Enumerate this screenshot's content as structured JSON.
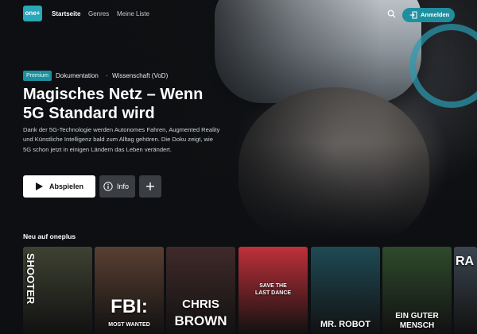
{
  "nav": {
    "logo_text": "one",
    "links": [
      "Startseite",
      "Genres",
      "Meine Liste"
    ],
    "login_label": "Anmelden",
    "accent_color": "#1e8f9f"
  },
  "hero": {
    "badge": "Premium",
    "category": "Dokumentation",
    "separator": "·",
    "genre": "Wissenschaft (VoD)",
    "title_line1": "Magisches Netz – Wenn",
    "title_line2": "5G Standard wird",
    "description": "Dank der 5G-Technologie werden Autonomes Fahren, Augmented Reality und Künstliche Intelligenz bald zum Alltag gehören. Die Doku zeigt, wie 5G schon jetzt in einigen Ländern das Leben verändert.",
    "play_label": "Abspielen",
    "info_label": "Info"
  },
  "row": {
    "title": "Neu auf oneplus",
    "posters": [
      {
        "title": "SHOOTER",
        "color": "#3e4232"
      },
      {
        "title": "FBI:",
        "subtitle": "MOST WANTED",
        "color": "#5a3f32"
      },
      {
        "title": "CHRIS",
        "subtitle": "BROWN",
        "color": "#402a2a"
      },
      {
        "title": "SAVE THE",
        "subtitle": "LAST DANCE",
        "color": "#c0303a"
      },
      {
        "title": "MR. ROBOT",
        "color": "#1f4a55"
      },
      {
        "title": "EIN GUTER",
        "subtitle": "MENSCH",
        "color": "#2f4a2c"
      },
      {
        "title": "RA",
        "color": "#3a4550"
      }
    ]
  }
}
